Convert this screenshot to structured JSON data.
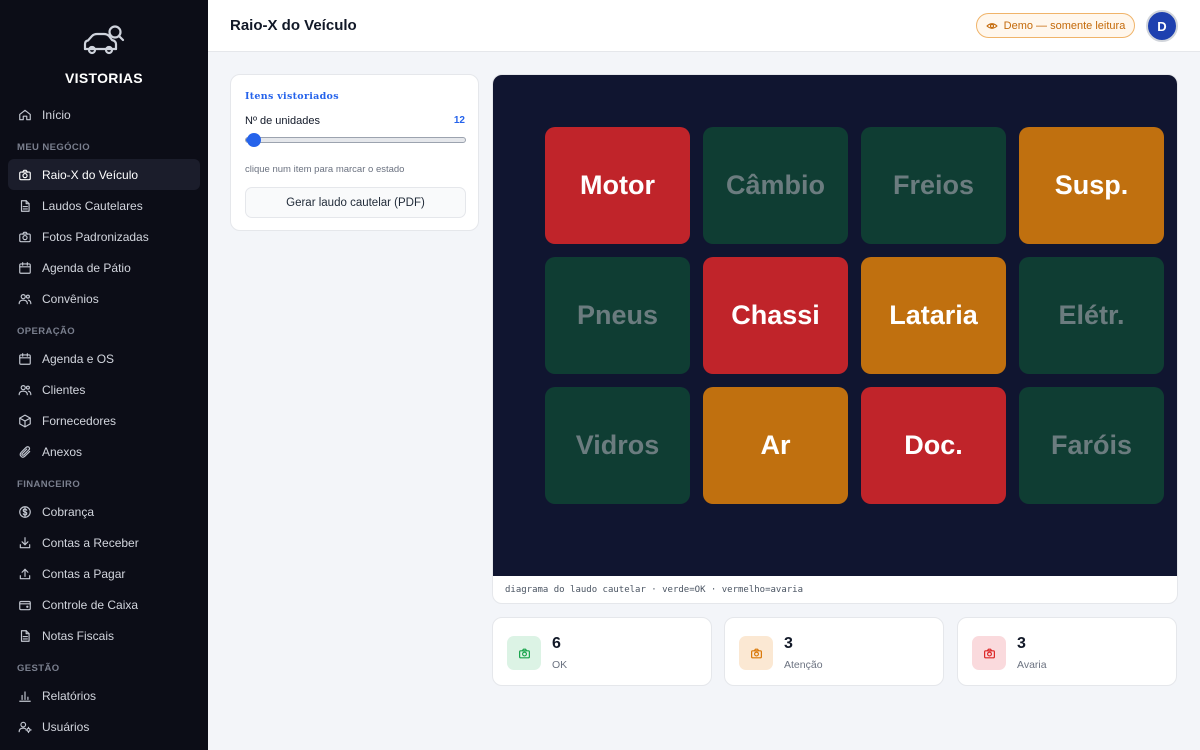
{
  "brand": {
    "name": "VISTORIAS"
  },
  "nav": [
    {
      "type": "item",
      "label": "Início",
      "icon": "home-icon"
    },
    {
      "type": "section",
      "label": "MEU NEGÓCIO"
    },
    {
      "type": "item",
      "label": "Raio-X do Veículo",
      "icon": "camera-icon",
      "active": true
    },
    {
      "type": "item",
      "label": "Laudos Cautelares",
      "icon": "document-icon"
    },
    {
      "type": "item",
      "label": "Fotos Padronizadas",
      "icon": "camera-icon"
    },
    {
      "type": "item",
      "label": "Agenda de Pátio",
      "icon": "calendar-icon"
    },
    {
      "type": "item",
      "label": "Convênios",
      "icon": "users-icon"
    },
    {
      "type": "section",
      "label": "OPERAÇÃO"
    },
    {
      "type": "item",
      "label": "Agenda e OS",
      "icon": "calendar-icon"
    },
    {
      "type": "item",
      "label": "Clientes",
      "icon": "users-icon"
    },
    {
      "type": "item",
      "label": "Fornecedores",
      "icon": "box-icon"
    },
    {
      "type": "item",
      "label": "Anexos",
      "icon": "paperclip-icon"
    },
    {
      "type": "section",
      "label": "FINANCEIRO"
    },
    {
      "type": "item",
      "label": "Cobrança",
      "icon": "dollar-icon"
    },
    {
      "type": "item",
      "label": "Contas a Receber",
      "icon": "download-icon"
    },
    {
      "type": "item",
      "label": "Contas a Pagar",
      "icon": "upload-icon"
    },
    {
      "type": "item",
      "label": "Controle de Caixa",
      "icon": "wallet-icon"
    },
    {
      "type": "item",
      "label": "Notas Fiscais",
      "icon": "document-icon"
    },
    {
      "type": "section",
      "label": "GESTÃO"
    },
    {
      "type": "item",
      "label": "Relatórios",
      "icon": "bar-chart-icon"
    },
    {
      "type": "item",
      "label": "Usuários",
      "icon": "user-gear-icon"
    }
  ],
  "topbar": {
    "title": "Raio-X do Veículo",
    "demo_badge": "Demo — somente leitura",
    "avatar_initial": "D"
  },
  "panel": {
    "title": "Itens vistoriados",
    "units_label": "Nº de unidades",
    "units_value": "12",
    "slider": {
      "min": 12,
      "max": 100,
      "value": 12
    },
    "hint": "clique num item para marcar o estado",
    "pdf_button": "Gerar laudo cautelar (PDF)"
  },
  "diagram": {
    "items": [
      {
        "label": "Motor",
        "state": "bad"
      },
      {
        "label": "Câmbio",
        "state": "ok"
      },
      {
        "label": "Freios",
        "state": "ok"
      },
      {
        "label": "Susp.",
        "state": "warn"
      },
      {
        "label": "Pneus",
        "state": "ok"
      },
      {
        "label": "Chassi",
        "state": "bad"
      },
      {
        "label": "Lataria",
        "state": "warn"
      },
      {
        "label": "Elétr.",
        "state": "ok"
      },
      {
        "label": "Vidros",
        "state": "ok"
      },
      {
        "label": "Ar",
        "state": "warn"
      },
      {
        "label": "Doc.",
        "state": "bad"
      },
      {
        "label": "Faróis",
        "state": "ok"
      }
    ],
    "caption": "diagrama do laudo cautelar · verde=OK · vermelho=avaria"
  },
  "stats": [
    {
      "value": "6",
      "label": "OK",
      "color": "#16a34a",
      "bg": "#dcf3e5"
    },
    {
      "value": "3",
      "label": "Atenção",
      "color": "#d97706",
      "bg": "#fbe8d3"
    },
    {
      "value": "3",
      "label": "Avaria",
      "color": "#dc2626",
      "bg": "#fadadd"
    }
  ],
  "colors": {
    "ok": "#0f3d33",
    "warn": "#c0700f",
    "bad": "#c0242a",
    "accent": "#2563eb"
  }
}
